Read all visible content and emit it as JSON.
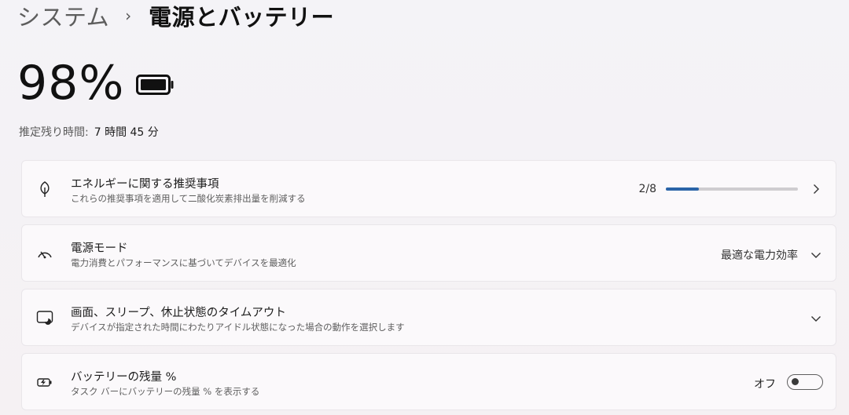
{
  "breadcrumb": {
    "parent": "システム",
    "separator": "›",
    "current": "電源とバッテリー"
  },
  "battery": {
    "percent_text": "98%",
    "remaining_label": "推定残り時間:",
    "remaining_value": "7 時間 45 分"
  },
  "cards": {
    "energy": {
      "title": "エネルギーに関する推奨事項",
      "subtitle": "これらの推奨事項を適用して二酸化炭素排出量を削減する",
      "progress_text": "2/8",
      "progress_fraction": 0.25,
      "icon": "leaf-icon"
    },
    "power_mode": {
      "title": "電源モード",
      "subtitle": "電力消費とパフォーマンスに基づいてデバイスを最適化",
      "value": "最適な電力効率",
      "icon": "speedometer-icon"
    },
    "sleep": {
      "title": "画面、スリープ、休止状態のタイムアウト",
      "subtitle": "デバイスが指定された時間にわたりアイドル状態になった場合の動作を選択します",
      "icon": "screen-sleep-icon"
    },
    "battery_pct": {
      "title": "バッテリーの残量 %",
      "subtitle": "タスク バーにバッテリーの残量 % を表示する",
      "toggle_label": "オフ",
      "toggle_on": false,
      "icon": "battery-charging-icon"
    }
  },
  "colors": {
    "accent": "#2a64a8",
    "track": "#cfcdd0"
  }
}
